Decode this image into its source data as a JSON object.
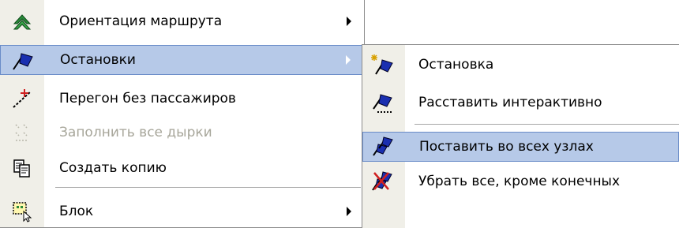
{
  "main_menu": {
    "items": [
      {
        "label": "Ориентация маршрута",
        "icon": "route-orientation-icon",
        "has_submenu": true,
        "disabled": false
      },
      {
        "label": "Остановки",
        "icon": "stops-icon",
        "has_submenu": true,
        "highlighted": true
      },
      {
        "label": "Перегон без пассажиров",
        "icon": "empty-run-icon",
        "has_submenu": false
      },
      {
        "label": "Заполнить все дырки",
        "icon": "fill-gaps-icon",
        "has_submenu": false,
        "disabled": true
      },
      {
        "label": "Создать копию",
        "icon": "copy-icon",
        "has_submenu": false
      },
      {
        "label": "Блок",
        "icon": "block-select-icon",
        "has_submenu": true
      }
    ]
  },
  "sub_menu": {
    "items": [
      {
        "label": "Остановка",
        "icon": "new-stop-icon"
      },
      {
        "label": "Расставить интерактивно",
        "icon": "place-interactive-icon"
      },
      {
        "label": "Поставить во всех узлах",
        "icon": "place-all-nodes-icon",
        "highlighted": true
      },
      {
        "label": "Убрать все, кроме конечных",
        "icon": "remove-stops-icon"
      }
    ]
  },
  "colors": {
    "highlight": "#b6c9e8",
    "highlight_border": "#6a8cc8",
    "gutter": "#f0efe8",
    "disabled_text": "#a7a69a",
    "icon_blue": "#1a2fb0",
    "icon_green": "#2a8a3a",
    "icon_red": "#d02020"
  }
}
